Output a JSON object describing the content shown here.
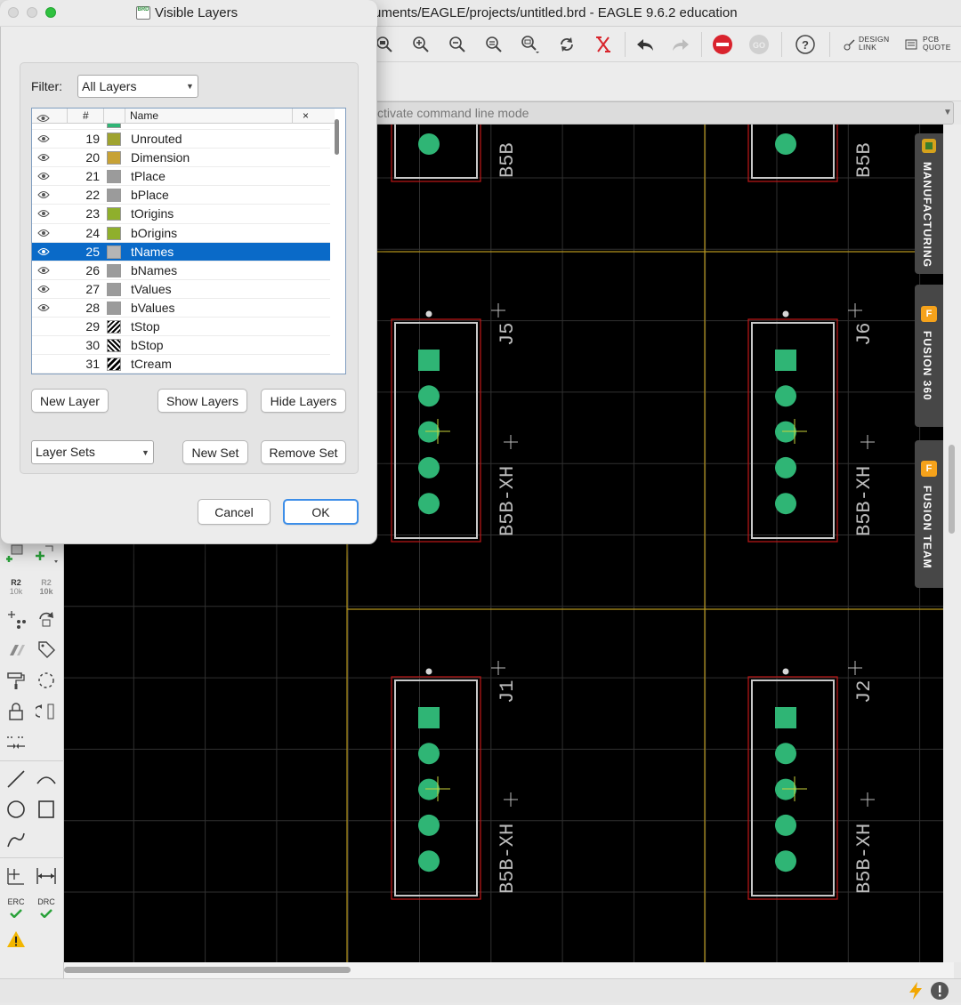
{
  "window": {
    "title": "uments/EAGLE/projects/untitled.brd - EAGLE 9.6.2 education",
    "command_placeholder": "ctivate command line mode"
  },
  "toolbar": {
    "design_link": [
      "DESIGN",
      "LINK"
    ],
    "pcb_quote": [
      "PCB",
      "QUOTE"
    ]
  },
  "left_tools": {
    "r2_top": "R2",
    "r2_bottom": "10k",
    "erc": "ERC",
    "drc": "DRC"
  },
  "side_panels": [
    {
      "label": "MANUFACTURING",
      "badge": ""
    },
    {
      "label": "FUSION 360",
      "badge": "F"
    },
    {
      "label": "FUSION TEAM",
      "badge": "F"
    }
  ],
  "canvas": {
    "components": [
      {
        "ref": "J5",
        "value": "B5B-XH"
      },
      {
        "ref": "J6",
        "value": "B5B-XH"
      },
      {
        "ref": "J1",
        "value": "B5B-XH"
      },
      {
        "ref": "J2",
        "value": "B5B-XH"
      }
    ],
    "partial_label": "B5B",
    "colors": {
      "pad": "#2fb575",
      "outline": "#c8c8c8",
      "keepout": "#c01818",
      "dimension": "#b5951c",
      "grid": "#303030"
    }
  },
  "dialog": {
    "title": "Visible Layers",
    "icon_text": "BRD",
    "filter_label": "Filter:",
    "filter_value": "All Layers",
    "columns": {
      "hash": "#",
      "name": "Name",
      "close": "×"
    },
    "layers": [
      {
        "num": "19",
        "name": "Unrouted",
        "color": "#9fa32f",
        "pattern": "solid",
        "visible": true,
        "selected": false
      },
      {
        "num": "20",
        "name": "Dimension",
        "color": "#c7a235",
        "pattern": "solid",
        "visible": true,
        "selected": false
      },
      {
        "num": "21",
        "name": "tPlace",
        "color": "#9b9b9b",
        "pattern": "solid",
        "visible": true,
        "selected": false
      },
      {
        "num": "22",
        "name": "bPlace",
        "color": "#9b9b9b",
        "pattern": "solid",
        "visible": true,
        "selected": false
      },
      {
        "num": "23",
        "name": "tOrigins",
        "color": "#8faf2c",
        "pattern": "solid",
        "visible": true,
        "selected": false
      },
      {
        "num": "24",
        "name": "bOrigins",
        "color": "#8faf2c",
        "pattern": "solid",
        "visible": true,
        "selected": false
      },
      {
        "num": "25",
        "name": "tNames",
        "color": "#b5b5b5",
        "pattern": "solid",
        "visible": true,
        "selected": true
      },
      {
        "num": "26",
        "name": "bNames",
        "color": "#9b9b9b",
        "pattern": "solid",
        "visible": true,
        "selected": false
      },
      {
        "num": "27",
        "name": "tValues",
        "color": "#9b9b9b",
        "pattern": "solid",
        "visible": true,
        "selected": false
      },
      {
        "num": "28",
        "name": "bValues",
        "color": "#9b9b9b",
        "pattern": "solid",
        "visible": true,
        "selected": false
      },
      {
        "num": "29",
        "name": "tStop",
        "color": "#1a1a1a",
        "pattern": "hatch",
        "visible": false,
        "selected": false
      },
      {
        "num": "30",
        "name": "bStop",
        "color": "#1a1a1a",
        "pattern": "hatch-rev",
        "visible": false,
        "selected": false
      },
      {
        "num": "31",
        "name": "tCream",
        "color": "#1a1a1a",
        "pattern": "hatch-wide",
        "visible": false,
        "selected": false
      }
    ],
    "buttons": {
      "new_layer": "New Layer",
      "show_layers": "Show Layers",
      "hide_layers": "Hide Layers",
      "new_set": "New Set",
      "remove_set": "Remove Set",
      "cancel": "Cancel",
      "ok": "OK"
    },
    "layer_sets_value": "Layer Sets"
  }
}
